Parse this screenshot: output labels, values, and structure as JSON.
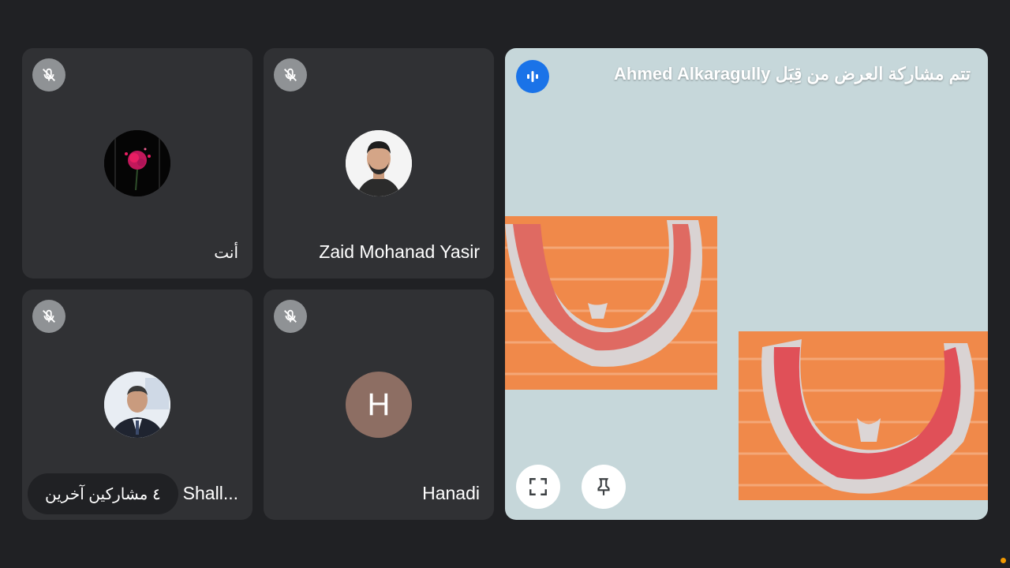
{
  "participants": [
    {
      "name": "أنت",
      "muted": true,
      "avatar": "rose-photo"
    },
    {
      "name": "Zaid Mohanad Yasir",
      "muted": true,
      "avatar": "person-photo"
    },
    {
      "name": "Shall...",
      "muted": true,
      "avatar": "person-photo"
    },
    {
      "name": "Hanadi",
      "muted": true,
      "avatar_letter": "H",
      "avatar_color": "#8d6e63"
    }
  ],
  "presentation": {
    "title": "تتم مشاركة العرض من قِبَل Ahmed Alkaragully",
    "background_color": "#c6d7da",
    "speaking_indicator_color": "#1a73e8"
  },
  "others_badge": "٤ مشاركين آخرين",
  "icons": [
    "mic-off-icon",
    "speaking-icon",
    "fullscreen-icon",
    "pin-icon"
  ]
}
